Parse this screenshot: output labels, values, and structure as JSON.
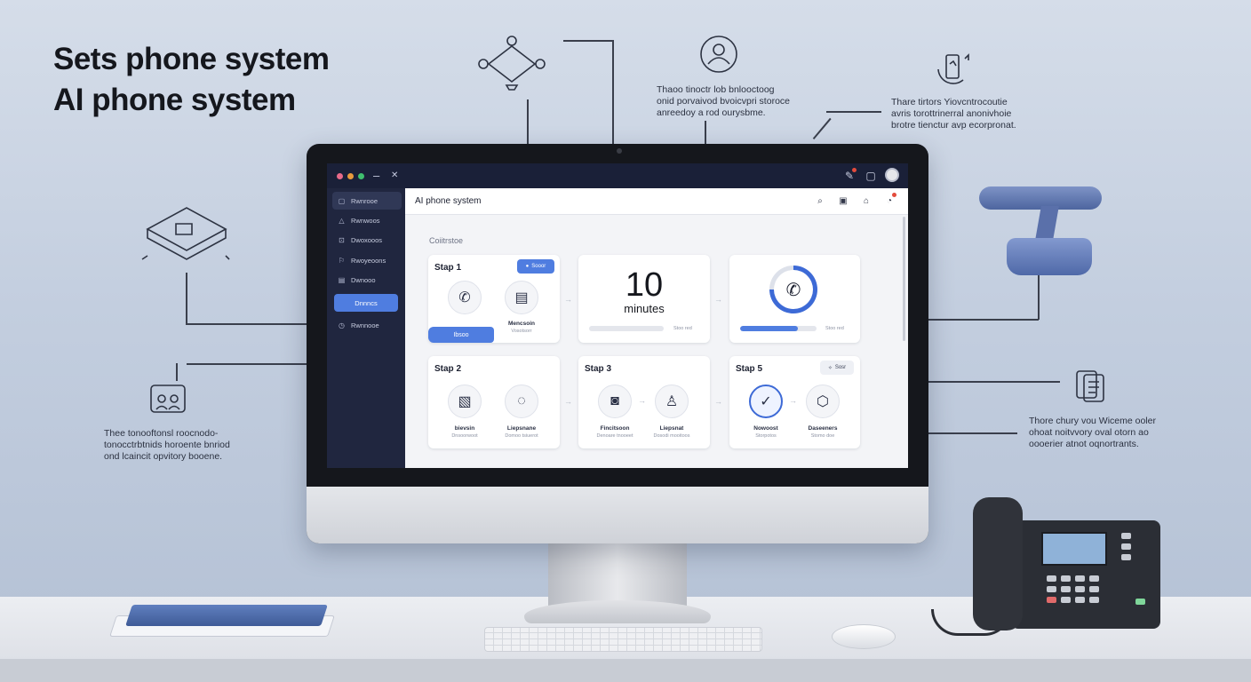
{
  "headline": {
    "line1": "Sets phone system",
    "line2": "AI phone system"
  },
  "callouts": {
    "top_center": [
      "Thaoo tinoctr lob bnlooctoog",
      "onid porvaivod bvoicvpri storoce",
      "anreedoy a rod ourysbme."
    ],
    "top_right": [
      "Thare tirtors Yiovcntrocoutie",
      "avris torottrinerral anonivhoie",
      "brotre tienctur avp ecorpronat."
    ],
    "left": [
      "Thee tonooftonsl roocnodo-",
      "tonocctrbtnids horoente bnriod",
      "ond lcaincit opvitory booene."
    ],
    "right": [
      "Thore chury vou Wiceme ooler",
      "ohoat noitvvory oval otorn ao",
      "oooerier atnot oqnortrants."
    ]
  },
  "titlebar": {
    "minimize_symbol": "–",
    "tool_symbol": "✕"
  },
  "sidebar": {
    "items": [
      {
        "label": "Rwnrooe",
        "icon": "chat-icon",
        "glyph": "▢",
        "selected": true
      },
      {
        "label": "Rwnwoos",
        "icon": "bell-icon",
        "glyph": "△",
        "selected": false
      },
      {
        "label": "Dwoxooos",
        "icon": "inbox-icon",
        "glyph": "⊡",
        "selected": false
      },
      {
        "label": "Rwoyeoons",
        "icon": "flag-icon",
        "glyph": "⚐",
        "selected": false
      },
      {
        "label": "Dwnooo",
        "icon": "chart-icon",
        "glyph": "▤",
        "selected": false
      }
    ],
    "action_button": "Dnnncs",
    "extra_item": {
      "label": "Rwnnooe",
      "icon": "clock-icon",
      "glyph": "◷"
    }
  },
  "header": {
    "title": "AI phone system"
  },
  "section_label": "Coiitrstoe",
  "cards": {
    "step1": {
      "title": "Stap 1",
      "badge": "Sooor",
      "caption": "Mencsoin",
      "subcaption": "Vosotsorr",
      "button": "Ibsoo"
    },
    "metric": {
      "value": "10",
      "unit": "minutes",
      "note": "Stoo red",
      "progress": 0
    },
    "ring": {
      "progress_pct": 75,
      "note": "Stoo red",
      "bar_progress": 0.75
    },
    "step2": {
      "title": "Stap 2",
      "items": [
        {
          "caption": "bievsin",
          "sub": "Dnsoorwoot"
        },
        {
          "caption": "Liepsnane",
          "sub": "Domoo tsiuerot"
        }
      ]
    },
    "step3": {
      "title": "Stap 3",
      "items": [
        {
          "caption": "Fincitsoon",
          "sub": "Denoare tnooeet"
        },
        {
          "caption": "Liepsnat",
          "sub": "Dosodi mooitoos"
        }
      ]
    },
    "step5": {
      "title": "Stap 5",
      "badge": "Sosr",
      "items": [
        {
          "caption": "Nowoost",
          "sub": "Storpotos"
        },
        {
          "caption": "Daseeners",
          "sub": "Stomo doe"
        }
      ]
    }
  },
  "colors": {
    "accent": "#4f7de0",
    "sidebar_bg": "#20263f",
    "titlebar_bg": "#1a2038",
    "dot_red": "#e86a8a",
    "dot_yellow": "#e89a3c",
    "dot_green": "#3fbf6e"
  }
}
